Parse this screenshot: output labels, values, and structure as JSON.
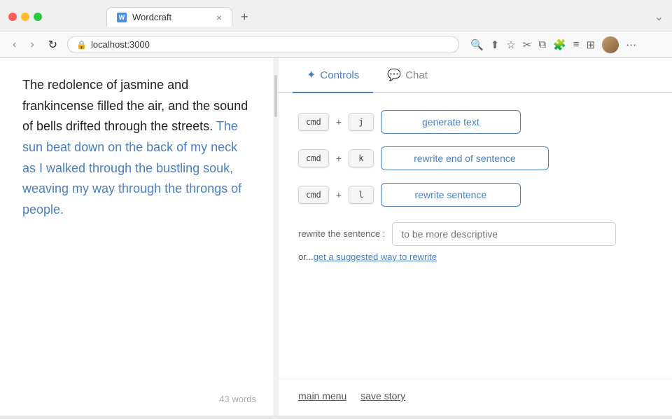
{
  "browser": {
    "tab_title": "Wordcraft",
    "address": "localhost:3000",
    "tab_close": "×",
    "tab_new": "+"
  },
  "nav": {
    "back": "‹",
    "forward": "›",
    "refresh": "↻"
  },
  "editor": {
    "normal_text_1": "The redolence of jasmine and frankincense filled the air, and the sound of bells drifted through the streets.",
    "highlighted_text": "The sun beat down on the back of my neck as I walked through the bustling souk, weaving my way through the throngs of people.",
    "word_count": "43 words"
  },
  "controls": {
    "tab_controls_label": "Controls",
    "tab_chat_label": "Chat",
    "shortcut1": {
      "mod": "cmd",
      "plus": "+",
      "key": "j",
      "button_label": "generate text"
    },
    "shortcut2": {
      "mod": "cmd",
      "plus": "+",
      "key": "k",
      "button_label": "rewrite end of sentence"
    },
    "shortcut3": {
      "mod": "cmd",
      "plus": "+",
      "key": "l",
      "button_label": "rewrite sentence"
    },
    "rewrite_label": "rewrite the sentence :",
    "rewrite_placeholder": "to be more descriptive",
    "rewrite_prefix": "or...",
    "rewrite_link": "get a suggested way to rewrite"
  },
  "footer": {
    "main_menu": "main menu",
    "save_story": "save story"
  }
}
